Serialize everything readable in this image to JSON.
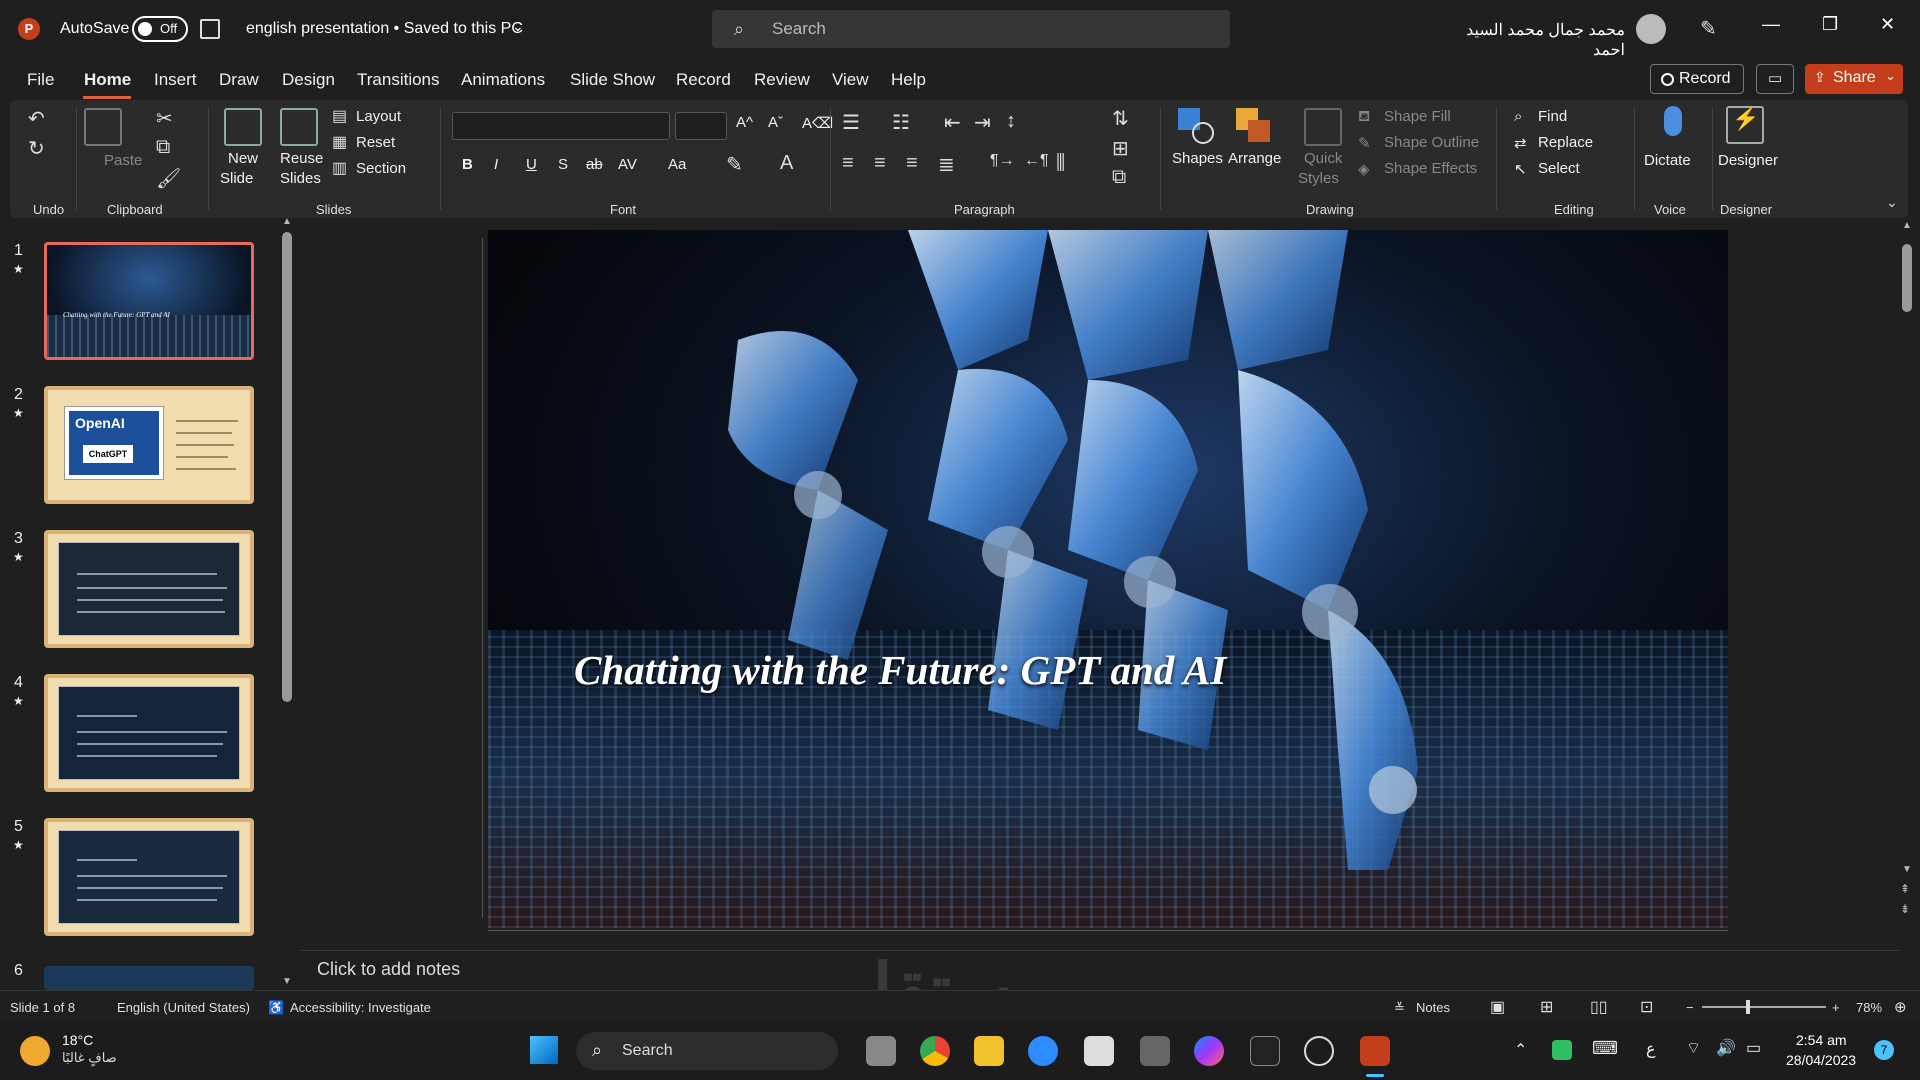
{
  "titlebar": {
    "app_logo": "P",
    "autosave_label": "AutoSave",
    "autosave_state": "Off",
    "doc_title": "english presentation • Saved to this PC",
    "search_placeholder": "Search",
    "user_name": "محمد جمال محمد السيد احمد"
  },
  "menu": {
    "items": [
      "File",
      "Home",
      "Insert",
      "Draw",
      "Design",
      "Transitions",
      "Animations",
      "Slide Show",
      "Record",
      "Review",
      "View",
      "Help"
    ],
    "record_label": "Record",
    "share_label": "Share"
  },
  "ribbon": {
    "groups": [
      "Undo",
      "Clipboard",
      "Slides",
      "Font",
      "Paragraph",
      "Drawing",
      "Editing",
      "Voice",
      "Designer"
    ],
    "paste": "Paste",
    "new_slide": "New",
    "new_slide_2": "Slide",
    "reuse": "Reuse",
    "reuse_2": "Slides",
    "layout": "Layout",
    "reset": "Reset",
    "section": "Section",
    "shapes": "Shapes",
    "arrange": "Arrange",
    "quick_styles": "Quick",
    "quick_styles_2": "Styles",
    "shape_fill": "Shape Fill",
    "shape_outline": "Shape Outline",
    "shape_effects": "Shape Effects",
    "find": "Find",
    "replace": "Replace",
    "select": "Select",
    "dictate": "Dictate",
    "designer": "Designer",
    "font_buttons": [
      "B",
      "I",
      "U",
      "S",
      "ab",
      "AV",
      "Aa"
    ]
  },
  "slides": {
    "numbers": [
      "1",
      "2",
      "3",
      "4",
      "5",
      "6"
    ],
    "thumb2_brand": "OpenAI",
    "thumb2_chip": "ChatGPT",
    "thumb1_caption": "Chatting with the Future: GPT and AI"
  },
  "slide": {
    "title": "Chatting with the Future: GPT and AI"
  },
  "notes": {
    "placeholder": "Click to add notes"
  },
  "status": {
    "slide_pos": "Slide 1 of 8",
    "language": "English (United States)",
    "accessibility": "Accessibility: Investigate",
    "notes_label": "Notes",
    "zoom": "78%"
  },
  "taskbar": {
    "temperature": "18°C",
    "weather": "صافٍ غالبًا",
    "search": "Search",
    "time": "2:54 am",
    "date": "28/04/2023",
    "notification_count": "7",
    "lang": "ع"
  },
  "watermark": "مستقل"
}
